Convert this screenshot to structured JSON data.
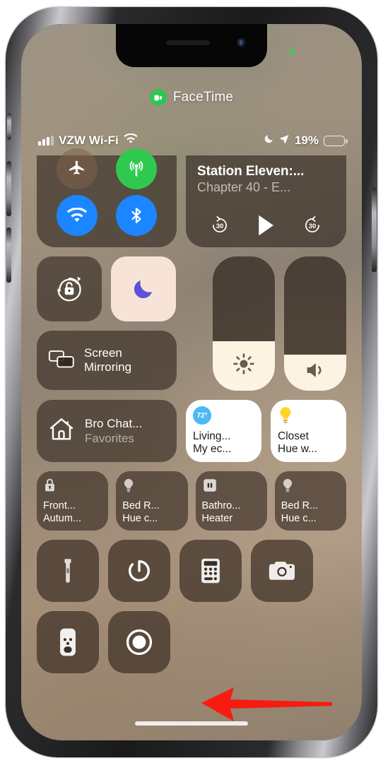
{
  "facetime": {
    "label": "FaceTime",
    "icon": "video-camera-icon",
    "accent": "#2dc653"
  },
  "status_bar": {
    "carrier": "VZW Wi-Fi",
    "signal_icon": "cellular-bars-icon",
    "wifi_icon": "wifi-icon",
    "dnd_icon": "moon-icon",
    "location_icon": "location-arrow-icon",
    "battery_percent": "19%",
    "battery_level": 19,
    "battery_color": "#f5c518"
  },
  "connectivity": {
    "airplane": {
      "name": "airplane-mode",
      "icon": "airplane-icon",
      "active": false,
      "color": "#806048"
    },
    "cellular": {
      "name": "cellular-data",
      "icon": "antenna-icon",
      "active": true,
      "color": "#30c94f"
    },
    "wifi": {
      "name": "wifi",
      "icon": "wifi-icon",
      "active": true,
      "color": "#1b86ff"
    },
    "bluetooth": {
      "name": "bluetooth",
      "icon": "bluetooth-icon",
      "active": true,
      "color": "#1b86ff"
    }
  },
  "media": {
    "title": "Station Eleven:...",
    "subtitle": "Chapter 40  -  E...",
    "rewind_label": "30",
    "forward_label": "30",
    "play_icon": "play-icon"
  },
  "toggles": {
    "rotation_lock": {
      "label": "Rotation Lock",
      "icon": "rotation-lock-icon",
      "active": false
    },
    "do_not_disturb": {
      "label": "Do Not Disturb",
      "icon": "moon-icon",
      "active": true,
      "color": "#f8e3d8"
    },
    "screen_mirroring": {
      "label": "Screen\nMirroring",
      "line1": "Screen",
      "line2": "Mirroring",
      "icon": "screen-mirroring-icon"
    }
  },
  "sliders": {
    "brightness": {
      "label": "Brightness",
      "icon": "sun-icon",
      "value": 37
    },
    "volume": {
      "label": "Volume",
      "icon": "speaker-icon",
      "value": 27
    }
  },
  "home": {
    "title": "Bro Chat...",
    "subtitle": "Favorites",
    "icon": "house-icon"
  },
  "accessory_cards": [
    {
      "line1": "Living...",
      "line2": "My ec...",
      "icon": "thermostat-icon",
      "badge": "72°",
      "badge_color": "#4cb8f5",
      "on": true
    },
    {
      "line1": "Closet",
      "line2": "Hue w...",
      "icon": "lightbulb-icon",
      "badge_color": "#ffd426",
      "on": true
    }
  ],
  "small_accessories": [
    {
      "line1": "Front...",
      "line2": "Autum...",
      "icon": "lock-icon"
    },
    {
      "line1": "Bed R...",
      "line2": "Hue c...",
      "icon": "lightbulb-icon"
    },
    {
      "line1": "Bathro...",
      "line2": "Heater",
      "icon": "outlet-icon"
    },
    {
      "line1": "Bed R...",
      "line2": "Hue c...",
      "icon": "lightbulb-icon"
    }
  ],
  "utilities": [
    {
      "label": "Flashlight",
      "icon": "flashlight-icon"
    },
    {
      "label": "Timer",
      "icon": "timer-icon"
    },
    {
      "label": "Calculator",
      "icon": "calculator-icon"
    },
    {
      "label": "Camera",
      "icon": "camera-icon"
    }
  ],
  "extras": [
    {
      "label": "Apple TV Remote",
      "icon": "remote-icon"
    },
    {
      "label": "Screen Recording",
      "icon": "record-icon"
    }
  ],
  "annotation": {
    "type": "arrow",
    "direction": "left",
    "color": "#f71b10",
    "points_at": "Screen Recording"
  }
}
